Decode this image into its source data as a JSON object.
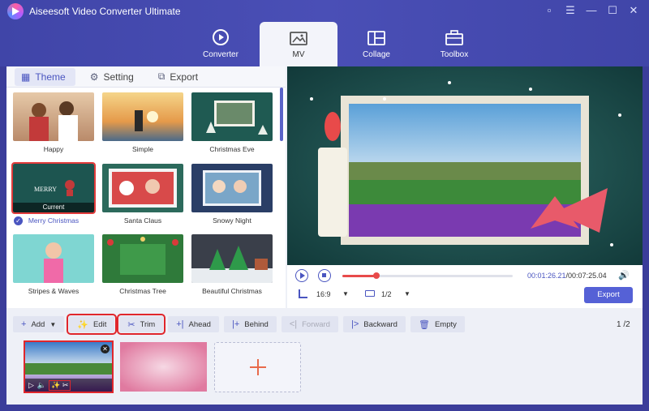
{
  "app": {
    "title": "Aiseesoft Video Converter Ultimate",
    "window_buttons": [
      "feedback-icon",
      "menu-icon",
      "minimize-icon",
      "maximize-icon",
      "close-icon"
    ]
  },
  "nav": [
    {
      "label": "Converter",
      "icon": "converter-icon"
    },
    {
      "label": "MV",
      "icon": "mv-icon",
      "active": true
    },
    {
      "label": "Collage",
      "icon": "collage-icon"
    },
    {
      "label": "Toolbox",
      "icon": "toolbox-icon"
    }
  ],
  "left_tabs": [
    {
      "label": "Theme",
      "icon": "grid-icon",
      "active": true
    },
    {
      "label": "Setting",
      "icon": "gear-icon"
    },
    {
      "label": "Export",
      "icon": "export-icon"
    }
  ],
  "themes": [
    {
      "label": "Happy"
    },
    {
      "label": "Simple"
    },
    {
      "label": "Christmas Eve"
    },
    {
      "label": "Merry Christmas",
      "selected": true,
      "tag": "Current"
    },
    {
      "label": "Santa Claus"
    },
    {
      "label": "Snowy Night"
    },
    {
      "label": "Stripes & Waves"
    },
    {
      "label": "Christmas Tree"
    },
    {
      "label": "Beautiful Christmas"
    }
  ],
  "player": {
    "current_time": "00:01:26.21",
    "total_time": "/00:07:25.04",
    "progress": 0.2,
    "aspect": "16:9",
    "screen": "1/2",
    "export_label": "Export"
  },
  "toolbar": {
    "add": "Add",
    "edit": "Edit",
    "trim": "Trim",
    "ahead": "Ahead",
    "behind": "Behind",
    "forward": "Forward",
    "backward": "Backward",
    "empty": "Empty",
    "page_current": "1",
    "page_total": "2"
  }
}
